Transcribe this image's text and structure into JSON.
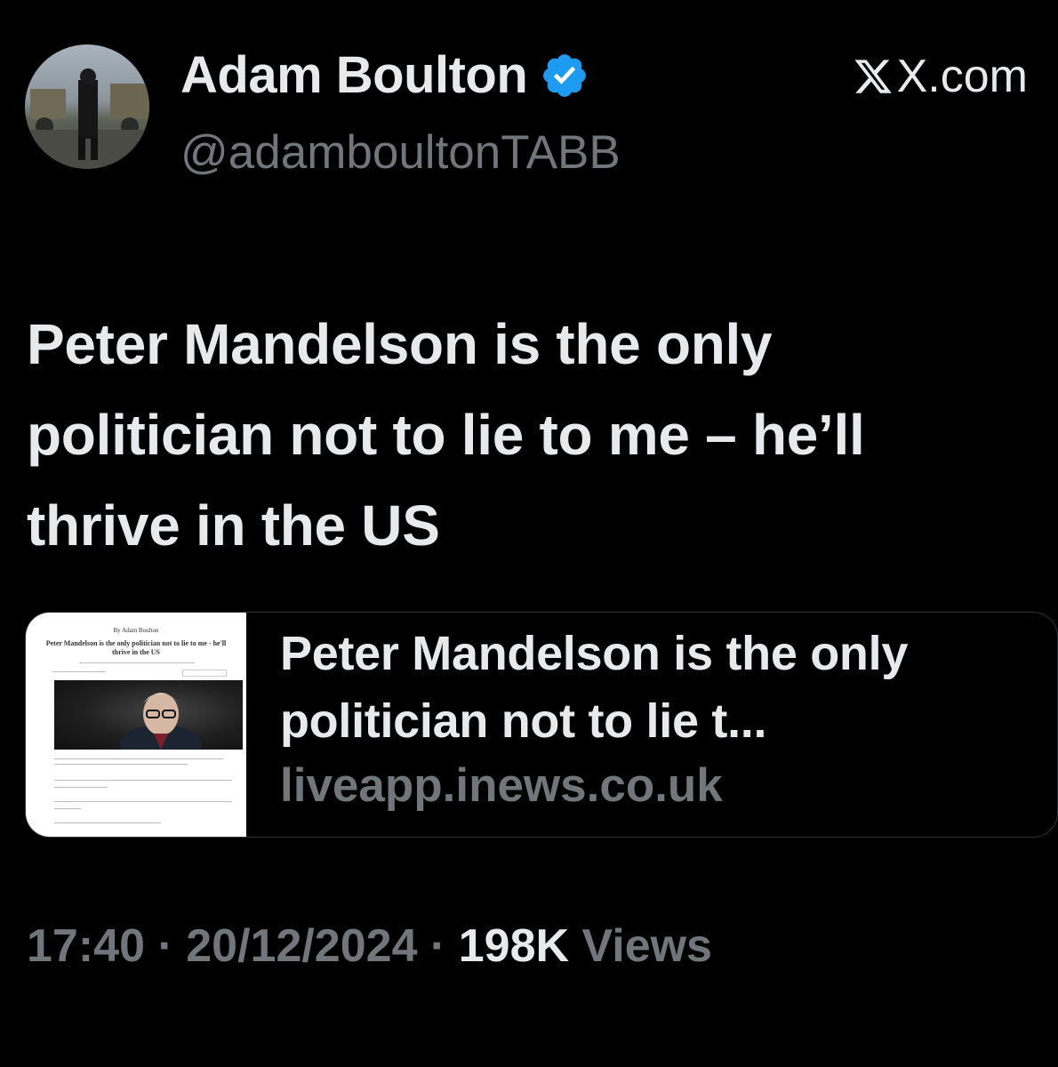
{
  "author": {
    "display_name": "Adam Boulton",
    "handle": "@adamboultonTABB",
    "verified": true,
    "avatar_icon": "profile-photo"
  },
  "source": {
    "label": "X.com",
    "logo_icon": "x-logo"
  },
  "tweet": {
    "text": "Peter Mandelson is the only politician not to lie to me – he’ll thrive in the US"
  },
  "link_card": {
    "title": "Peter Mandelson is the only politician not to lie t...",
    "domain": "liveapp.inews.co.uk",
    "thumbnail": {
      "byline": "By Adam Boulton",
      "headline": "Peter Mandelson is the only politician not to lie to me - he'll thrive in the US"
    }
  },
  "meta": {
    "time": "17:40",
    "date": "20/12/2024",
    "views_count": "198K",
    "views_label": "Views",
    "separator": "·"
  },
  "colors": {
    "background": "#000000",
    "primary_text": "#e7e9ea",
    "secondary_text": "#71767b",
    "verified_blue": "#1d9bf0",
    "card_border": "#2f3336"
  }
}
